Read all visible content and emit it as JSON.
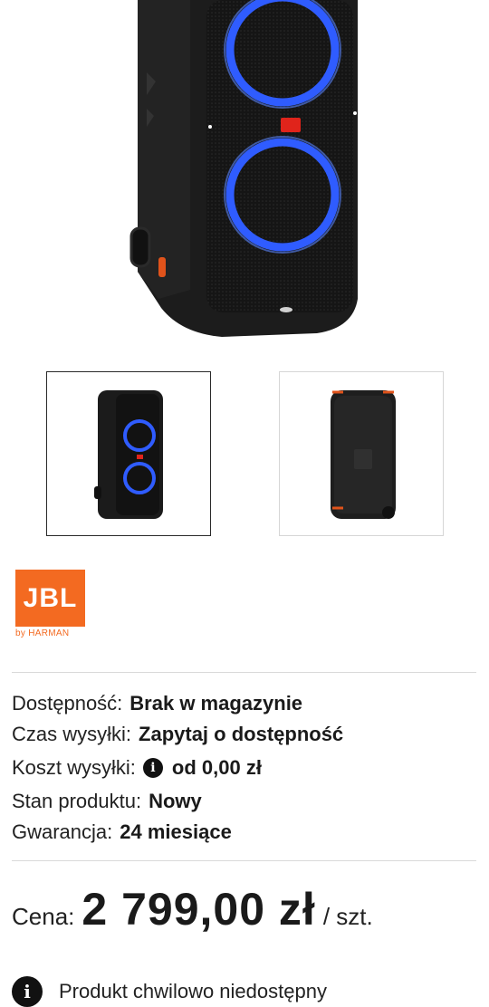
{
  "product": {
    "brand": {
      "logo_text": "JBL",
      "sub_text": "by HARMAN",
      "color": "#f36a21"
    },
    "specs": [
      {
        "label": "Dostępność:",
        "value": "Brak w magazynie"
      },
      {
        "label": "Czas wysyłki:",
        "value": "Zapytaj o dostępność"
      },
      {
        "label": "Koszt wysyłki:",
        "value": "od 0,00 zł",
        "icon": "info-icon"
      },
      {
        "label": "Stan produktu:",
        "value": "Nowy"
      },
      {
        "label": "Gwarancja:",
        "value": "24 miesiące"
      }
    ],
    "price": {
      "label": "Cena:",
      "value": "2 799,00 zł",
      "unit": "/ szt."
    },
    "availability_note": "Produkt chwilowo niedostępny"
  },
  "gallery": {
    "thumbnails": [
      {
        "name": "front view",
        "active": true
      },
      {
        "name": "back view",
        "active": false
      }
    ],
    "accent_color": "#2f5cff"
  }
}
